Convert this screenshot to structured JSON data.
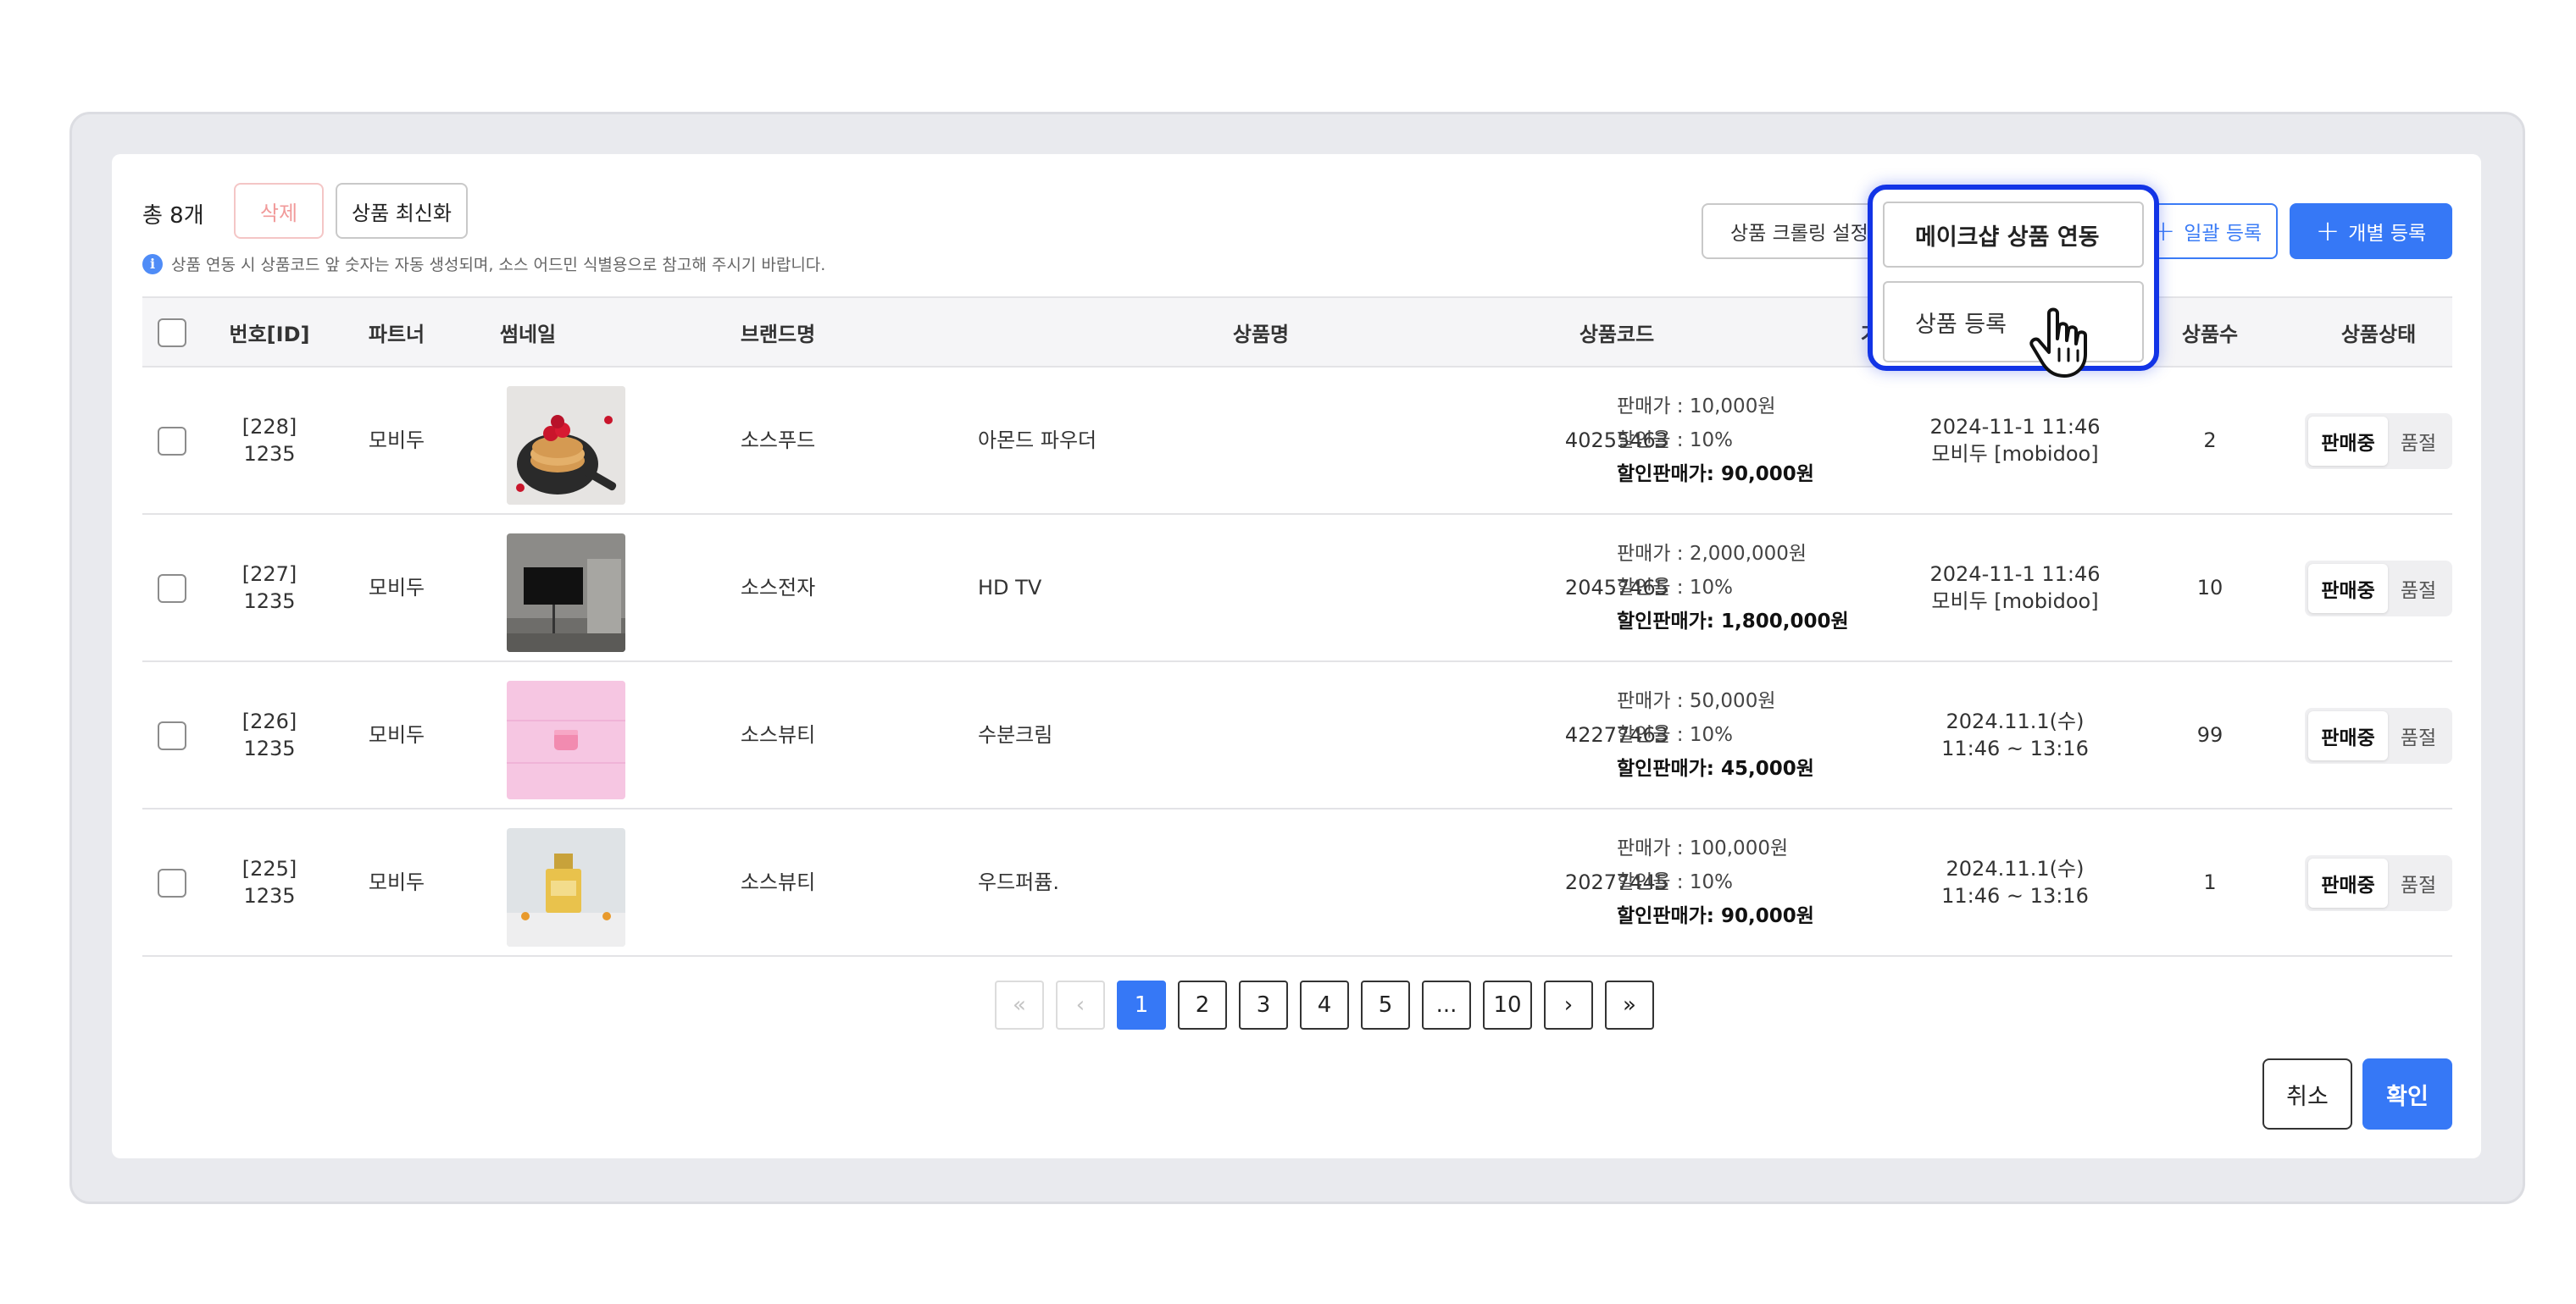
{
  "toolbar": {
    "total_label": "총 8개",
    "delete_label": "삭제",
    "refresh_label": "상품 최신화",
    "notice_text": "상품 연동 시 상품코드 앞 숫자는 자동 생성되며, 소스 어드민 식별용으로 참고해 주시기 바랍니다.",
    "crawl_label": "상품 크롤링 설정",
    "bulk_label": "일괄 등록",
    "single_label": "개별 등록",
    "single_plus": "+",
    "bulk_plus": "+"
  },
  "popup": {
    "item1": "메이크샵 상품 연동",
    "item2": "상품 등록"
  },
  "table": {
    "headers": {
      "id": "번호[ID]",
      "partner": "파트너",
      "thumbnail": "썸네일",
      "brand": "브랜드명",
      "name": "상품명",
      "code": "상품코드",
      "price": "가격",
      "count": "상품수",
      "status": "상품상태"
    },
    "rows": [
      {
        "id_line1": "[228]",
        "id_line2": "1235",
        "partner": "모비두",
        "brand": "소스푸드",
        "name": "아몬드 파우더",
        "code": "40255463",
        "price_sale": "판매가 : 10,000원",
        "price_rate": "할인율 : 10%",
        "price_final": "할인판매가: 90,000원",
        "date_line1": "2024-11-1 11:46",
        "date_line2": "모비두 [mobidoo]",
        "count": "2",
        "status_on": "판매중",
        "status_off": "품절"
      },
      {
        "id_line1": "[227]",
        "id_line2": "1235",
        "partner": "모비두",
        "brand": "소스전자",
        "name": "HD TV",
        "code": "20457465",
        "price_sale": "판매가 : 2,000,000원",
        "price_rate": "할인율 : 10%",
        "price_final": "할인판매가: 1,800,000원",
        "date_line1": "2024-11-1 11:46",
        "date_line2": "모비두 [mobidoo]",
        "count": "10",
        "status_on": "판매중",
        "status_off": "품절"
      },
      {
        "id_line1": "[226]",
        "id_line2": "1235",
        "partner": "모비두",
        "brand": "소스뷰티",
        "name": "수분크림",
        "code": "42277463",
        "price_sale": "판매가 : 50,000원",
        "price_rate": "할인율 : 10%",
        "price_final": "할인판매가: 45,000원",
        "date_line1": "2024.11.1(수)",
        "date_line2": "11:46 ~ 13:16",
        "count": "99",
        "status_on": "판매중",
        "status_off": "품절"
      },
      {
        "id_line1": "[225]",
        "id_line2": "1235",
        "partner": "모비두",
        "brand": "소스뷰티",
        "name": "우드퍼퓸.",
        "code": "20277445",
        "price_sale": "판매가 : 100,000원",
        "price_rate": "할인율 : 10%",
        "price_final": "할인판매가: 90,000원",
        "date_line1": "2024.11.1(수)",
        "date_line2": "11:46 ~ 13:16",
        "count": "1",
        "status_on": "판매중",
        "status_off": "품절"
      }
    ]
  },
  "pagination": {
    "first": "«",
    "prev": "‹",
    "next": "›",
    "last": "»",
    "pages": [
      "1",
      "2",
      "3",
      "4",
      "5",
      "...",
      "10"
    ]
  },
  "footer": {
    "cancel_label": "취소",
    "ok_label": "확인"
  },
  "colors": {
    "accent": "#3678f6",
    "popup_border": "#1234e6",
    "danger_text": "#f19a9a"
  }
}
